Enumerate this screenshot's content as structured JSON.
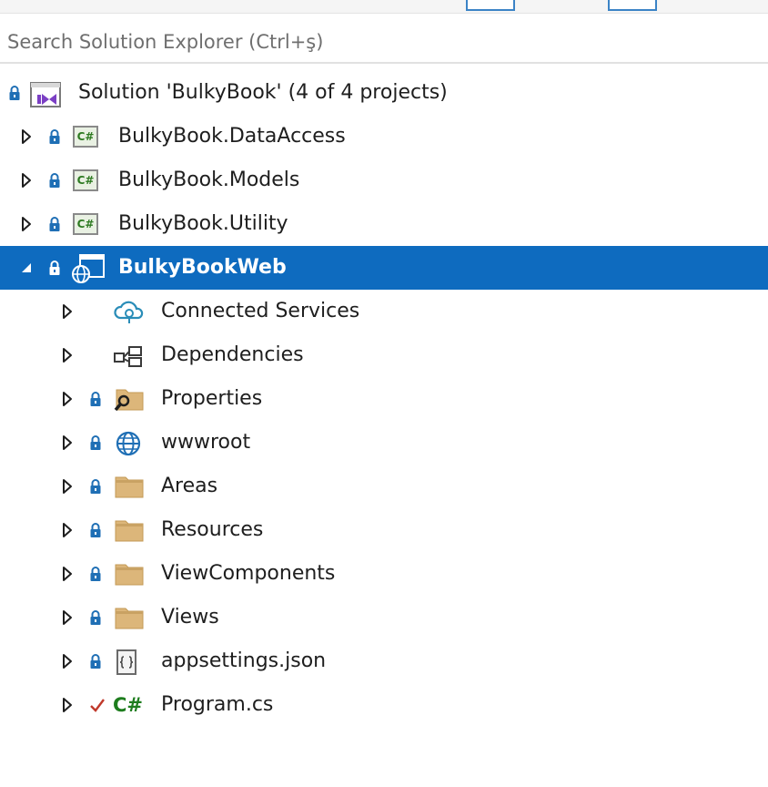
{
  "search": {
    "placeholder": "Search Solution Explorer (Ctrl+ş)"
  },
  "solution": {
    "label": "Solution 'BulkyBook' (4 of 4 projects)"
  },
  "projects": [
    {
      "label": "BulkyBook.DataAccess",
      "icon": "csharp-project-icon"
    },
    {
      "label": "BulkyBook.Models",
      "icon": "csharp-project-icon"
    },
    {
      "label": "BulkyBook.Utility",
      "icon": "csharp-project-icon"
    }
  ],
  "web_project": {
    "label": "BulkyBookWeb",
    "icon": "web-project-icon",
    "selected": true
  },
  "web_items": [
    {
      "label": "Connected Services",
      "icon": "connected-services-icon"
    },
    {
      "label": "Dependencies",
      "icon": "dependencies-icon"
    },
    {
      "label": "Properties",
      "icon": "properties-folder-icon"
    },
    {
      "label": "wwwroot",
      "icon": "globe-icon"
    },
    {
      "label": "Areas",
      "icon": "folder-icon"
    },
    {
      "label": "Resources",
      "icon": "folder-icon"
    },
    {
      "label": "ViewComponents",
      "icon": "folder-icon"
    },
    {
      "label": "Views",
      "icon": "folder-icon"
    },
    {
      "label": "appsettings.json",
      "icon": "json-file-icon"
    },
    {
      "label": "Program.cs",
      "icon": "csharp-file-icon"
    }
  ],
  "icon_labels": {
    "csharp": "C#"
  },
  "colors": {
    "selection": "#0e6bbf",
    "lock": "#1f6fb5",
    "folder": "#dcb67a",
    "csharp": "#2d7a21",
    "check": "#c0392b"
  }
}
